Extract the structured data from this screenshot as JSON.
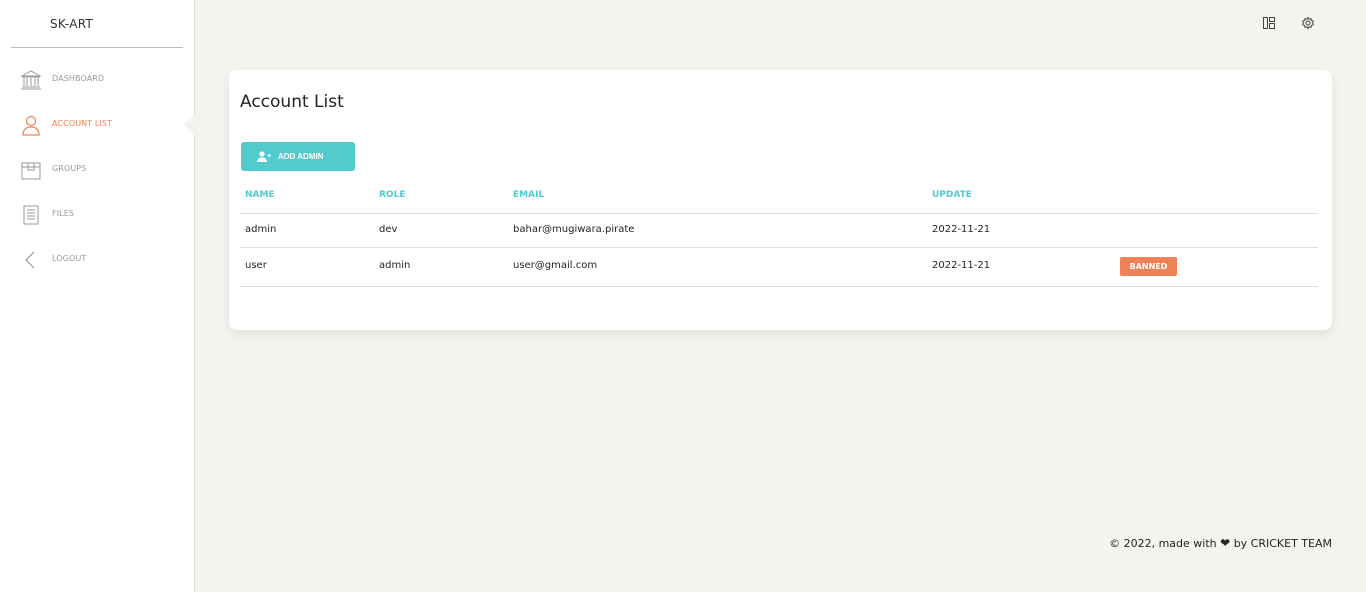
{
  "app": {
    "brand": "SK-ART"
  },
  "sidebar": {
    "items": [
      {
        "label": "DASHBOARD",
        "icon": "bank-icon",
        "active": false
      },
      {
        "label": "ACCOUNT LIST",
        "icon": "user-icon",
        "active": true
      },
      {
        "label": "GROUPS",
        "icon": "box-icon",
        "active": false
      },
      {
        "label": "FILES",
        "icon": "document-icon",
        "active": false
      },
      {
        "label": "LOGOUT",
        "icon": "chevron-left-icon",
        "active": false
      }
    ]
  },
  "topbar": {
    "icons": [
      "layout-icon",
      "gear-icon"
    ]
  },
  "main": {
    "title": "Account List",
    "add_button_label": "ADD ADMIN",
    "table": {
      "headers": [
        "NAME",
        "ROLE",
        "EMAIL",
        "UPDATE"
      ],
      "rows": [
        {
          "name": "admin",
          "role": "dev",
          "email": "bahar@mugiwara.pirate",
          "update": "2022-11-21",
          "status": ""
        },
        {
          "name": "user",
          "role": "admin",
          "email": "user@gmail.com",
          "update": "2022-11-21",
          "status": "BANNED"
        }
      ]
    }
  },
  "footer": {
    "prefix": "© 2022, made with",
    "suffix": "by CRICKET TEAM"
  },
  "colors": {
    "accent": "#51cbce",
    "active": "#ef8157",
    "badge": "#ef8157",
    "background": "#f4f3ef"
  }
}
